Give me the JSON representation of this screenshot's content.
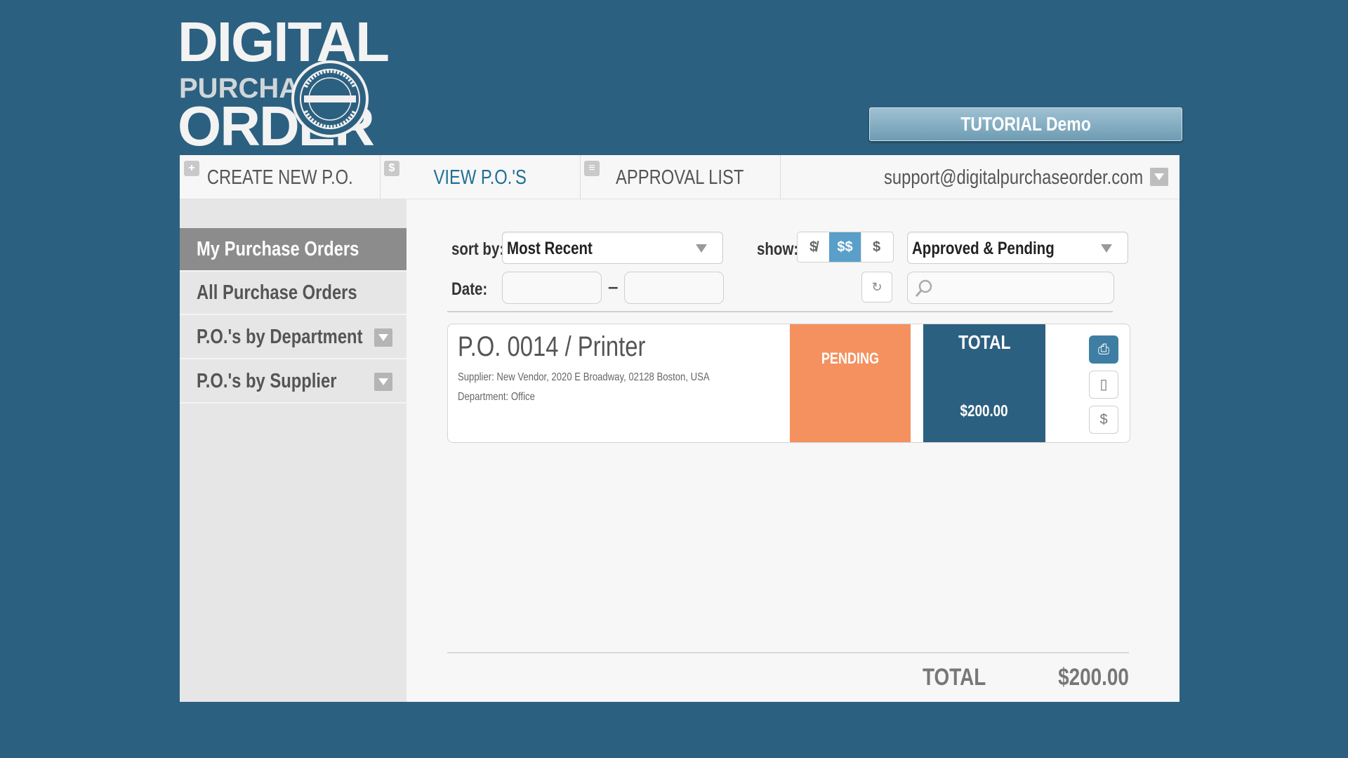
{
  "logo": {
    "line1": "DIGITAL",
    "line2": "PURCHASE",
    "line3": "ORDER",
    "seal_text": "FOR TELEVISION & FILM · DIGITAL PURCHASE ORDER"
  },
  "header": {
    "tutorial_button": "TUTORIAL Demo"
  },
  "nav": {
    "tabs": [
      {
        "label": "CREATE NEW P.O.",
        "icon": "plus-icon",
        "active": false
      },
      {
        "label": "VIEW P.O.'S",
        "icon": "dollar-icon",
        "active": true
      },
      {
        "label": "APPROVAL LIST",
        "icon": "list-icon",
        "active": false
      }
    ],
    "account_email": "support@digitalpurchaseorder.com"
  },
  "sidebar": {
    "items": [
      {
        "label": "My Purchase Orders",
        "active": true
      },
      {
        "label": "All Purchase Orders",
        "active": false
      },
      {
        "label": "P.O.'s by Department",
        "dropdown": true
      },
      {
        "label": "P.O.'s by Supplier",
        "dropdown": true
      }
    ]
  },
  "filters": {
    "sort_label": "sort by:",
    "sort_value": "Most Recent",
    "show_label": "show:",
    "show_options": [
      "$̸",
      "$$",
      "$"
    ],
    "status_value": "Approved & Pending",
    "date_label": "Date:",
    "date_separator": "–"
  },
  "orders": [
    {
      "title": "P.O. 0014 / Printer",
      "supplier": "Supplier: New Vendor, 2020 E Broadway, 02128 Boston, USA",
      "department": "Department: Office",
      "status": "PENDING",
      "total_label": "TOTAL",
      "total_value": "$200.00"
    }
  ],
  "summary": {
    "total_label": "TOTAL",
    "total_value": "$200.00"
  },
  "colors": {
    "background": "#2c6080",
    "pending": "#f4915f",
    "accent": "#1f6f95",
    "toggle_on": "#5a9fc9"
  }
}
